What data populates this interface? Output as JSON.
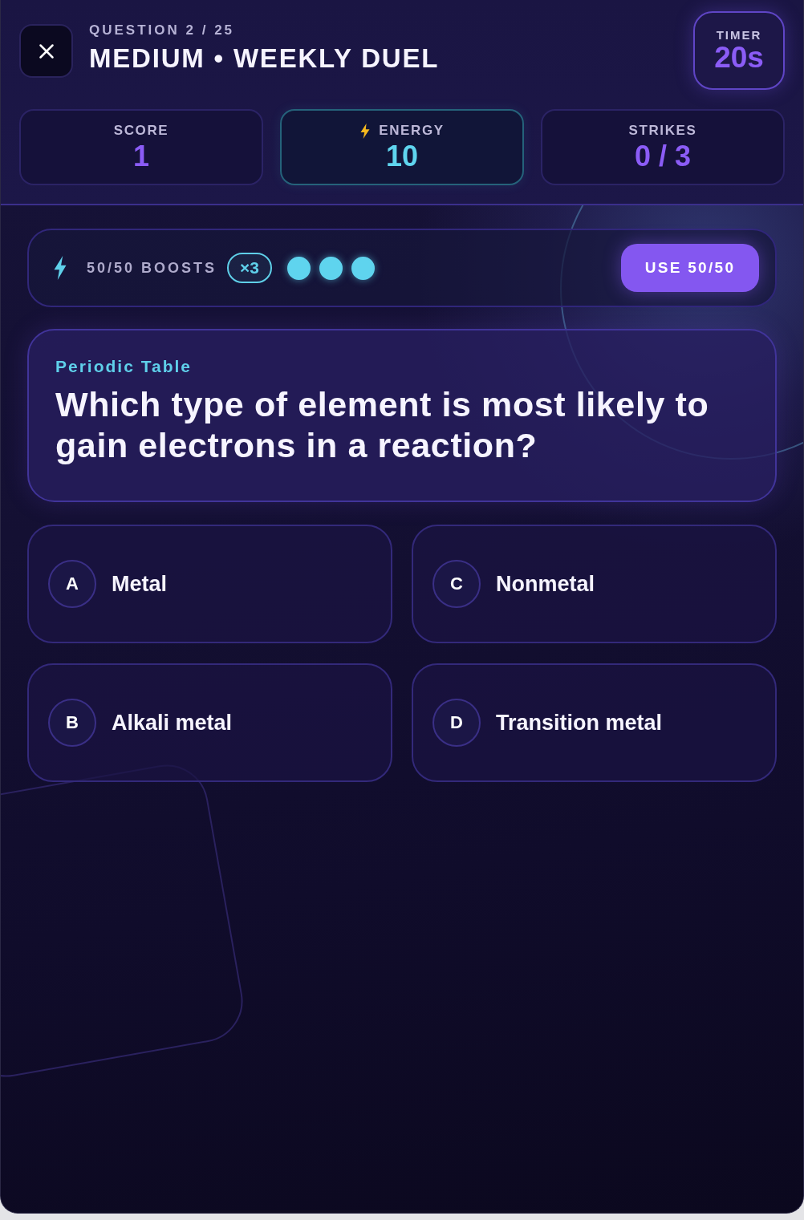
{
  "header": {
    "question_label": "QUESTION 2 / 25",
    "title": "MEDIUM • WEEKLY DUEL"
  },
  "timer": {
    "label": "TIMER",
    "value": "20s"
  },
  "stats": [
    {
      "kind": "plain",
      "label": "SCORE",
      "value": "1",
      "color": "#8b5cf6"
    },
    {
      "kind": "energy",
      "label": "ENERGY",
      "value": "10",
      "color": "#5fd4ee"
    },
    {
      "kind": "plain",
      "label": "STRIKES",
      "value": "0 / 3",
      "color": "#8b5cf6"
    }
  ],
  "boost_bar": {
    "label": "50/50 BOOSTS",
    "count": "×3",
    "charges": [
      {
        "filled": true
      },
      {
        "filled": true
      },
      {
        "filled": true
      }
    ],
    "button": "USE 50/50"
  },
  "question": {
    "topic": "Periodic Table",
    "text": "Which type of element is most likely to gain electrons in a reaction?"
  },
  "answers": [
    {
      "letter": "A",
      "text": "Metal"
    },
    {
      "letter": "B",
      "text": "Alkali metal"
    },
    {
      "letter": "C",
      "text": "Nonmetal"
    },
    {
      "letter": "D",
      "text": "Transition metal"
    }
  ]
}
